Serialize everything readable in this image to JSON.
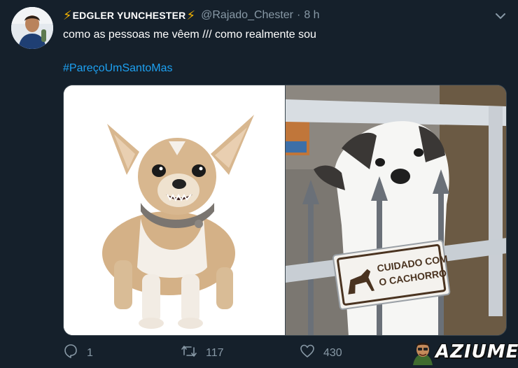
{
  "tweet": {
    "display_name": "EDGLER YUNCHESTER",
    "name_emoji_left": "⚡",
    "name_emoji_right": "⚡",
    "handle": "@Rajado_Chester",
    "separator": "·",
    "time": "8 h",
    "text": "como as pessoas me vêem /// como realmente sou",
    "hashtag": "#PareçoUmSantoMas"
  },
  "media": {
    "sign_line1": "CUIDADO COM",
    "sign_line2": "O CACHORRO"
  },
  "actions": {
    "reply_count": "1",
    "retweet_count": "117",
    "like_count": "430"
  },
  "watermark": {
    "text": "AZIUME"
  },
  "colors": {
    "background": "#15202b",
    "muted": "#8899a6",
    "link": "#1da1f2",
    "bolt": "#f5b400"
  },
  "icons": {
    "caret": "chevron-down-icon",
    "reply": "reply-icon",
    "retweet": "retweet-icon",
    "like": "heart-icon"
  }
}
